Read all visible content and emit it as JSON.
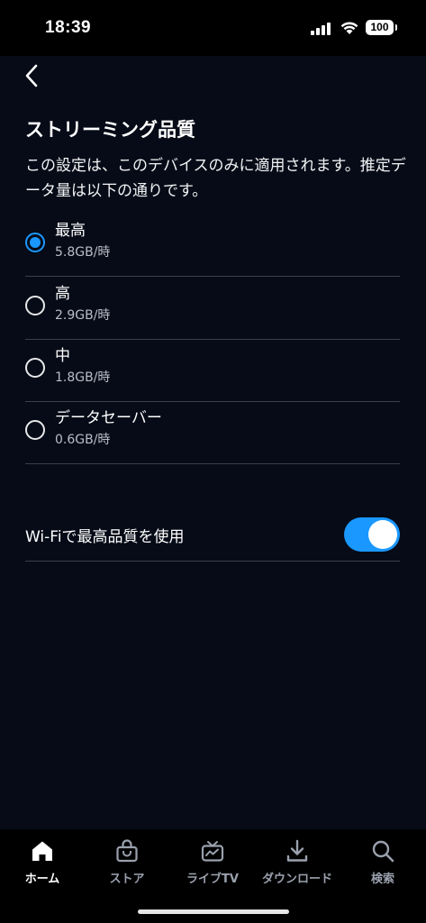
{
  "status_bar": {
    "time": "18:39",
    "battery": "100"
  },
  "header": {
    "title": "ストリーミング品質",
    "description": "この設定は、このデバイスのみに適用されます。推定データ量は以下の通りです。"
  },
  "quality_options": [
    {
      "label": "最高",
      "usage": "5.8GB/時",
      "selected": true
    },
    {
      "label": "高",
      "usage": "2.9GB/時",
      "selected": false
    },
    {
      "label": "中",
      "usage": "1.8GB/時",
      "selected": false
    },
    {
      "label": "データセーバー",
      "usage": "0.6GB/時",
      "selected": false
    }
  ],
  "wifi_setting": {
    "label": "Wi-Fiで最高品質を使用",
    "enabled": true
  },
  "tab_bar": {
    "items": [
      {
        "label": "ホーム",
        "icon": "home-icon",
        "active": true
      },
      {
        "label": "ストア",
        "icon": "store-bag-icon",
        "active": false
      },
      {
        "label": "ライブTV",
        "icon": "live-tv-icon",
        "active": false
      },
      {
        "label": "ダウンロード",
        "icon": "download-icon",
        "active": false
      },
      {
        "label": "検索",
        "icon": "search-icon",
        "active": false
      }
    ]
  },
  "colors": {
    "accent": "#1a98ff",
    "background": "#060b17",
    "divider": "#3a3f4a"
  }
}
